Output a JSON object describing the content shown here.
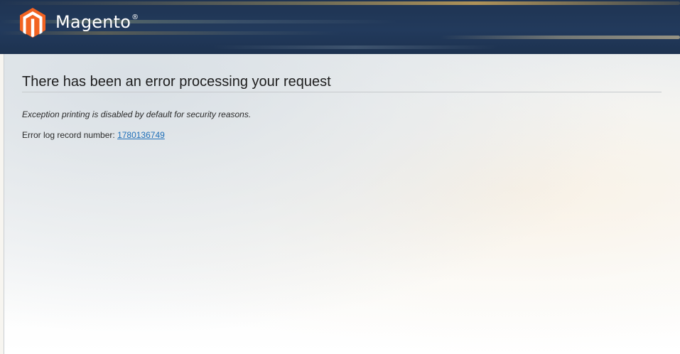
{
  "header": {
    "brand": "Magento",
    "registered_mark": "®",
    "logo_icon": "magento-hexagon-logo"
  },
  "main": {
    "title": "There has been an error processing your request",
    "message": "Exception printing is disabled by default for security reasons.",
    "log_label": "Error log record number:",
    "log_number": "1780136749"
  },
  "colors": {
    "header_bg": "#1f3452",
    "logo_orange": "#f26322",
    "link": "#1e6fb8"
  }
}
